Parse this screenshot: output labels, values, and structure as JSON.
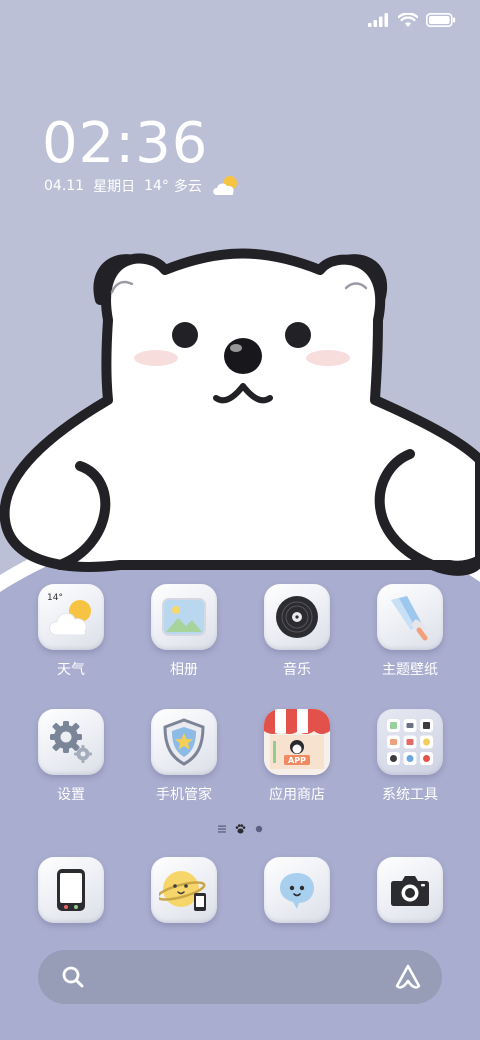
{
  "status_bar": {
    "icons": [
      "signal-icon",
      "wifi-icon",
      "battery-icon"
    ]
  },
  "clock": {
    "time": "02:36",
    "date": "04.11",
    "weekday": "星期日",
    "temperature": "14°",
    "condition": "多云",
    "weather_icon": "partly-cloudy-icon"
  },
  "apps": [
    {
      "id": "weather",
      "label": "天气",
      "icon": "weather-app-icon",
      "badge": "14°"
    },
    {
      "id": "gallery",
      "label": "相册",
      "icon": "gallery-app-icon"
    },
    {
      "id": "music",
      "label": "音乐",
      "icon": "music-app-icon"
    },
    {
      "id": "themes",
      "label": "主题壁纸",
      "icon": "themes-app-icon"
    },
    {
      "id": "settings",
      "label": "设置",
      "icon": "settings-app-icon"
    },
    {
      "id": "security",
      "label": "手机管家",
      "icon": "security-app-icon"
    },
    {
      "id": "appstore",
      "label": "应用商店",
      "icon": "appstore-app-icon",
      "badge": "APP"
    },
    {
      "id": "tools",
      "label": "系统工具",
      "icon": "tools-folder-icon"
    }
  ],
  "page_indicator": {
    "pages": 3,
    "current": 2
  },
  "dock": [
    {
      "id": "phone",
      "icon": "phone-app-icon"
    },
    {
      "id": "browser",
      "icon": "browser-app-icon"
    },
    {
      "id": "messages",
      "icon": "messages-app-icon"
    },
    {
      "id": "camera",
      "icon": "camera-app-icon"
    }
  ],
  "search": {
    "icons": [
      "search-icon",
      "assistant-icon"
    ]
  },
  "wallpaper": {
    "subject": "polar-bear-illustration",
    "colors": {
      "background": "#bcc0d6",
      "lower": "#a9adcf",
      "bear": "#ffffff",
      "outline": "#222226",
      "cheeks": "#f7dedd"
    }
  }
}
